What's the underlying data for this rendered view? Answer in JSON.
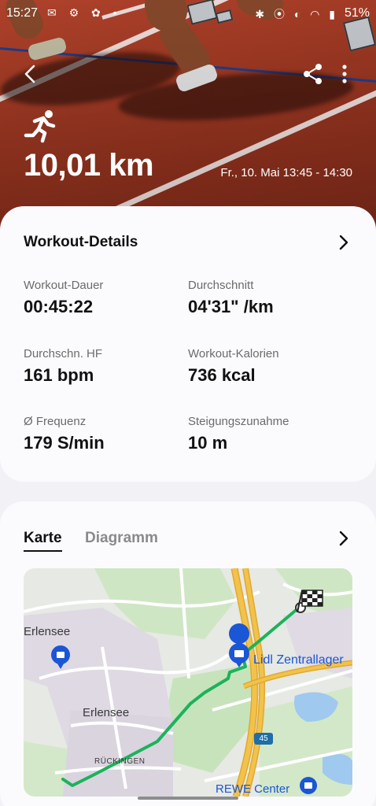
{
  "status_bar": {
    "time": "15:27",
    "battery": "51%"
  },
  "hero": {
    "distance": "10,01 km",
    "date_range": "Fr., 10. Mai 13:45 - 14:30"
  },
  "details": {
    "title": "Workout-Details",
    "metrics": [
      {
        "label": "Workout-Dauer",
        "value": "00:45:22"
      },
      {
        "label": "Durchschnitt",
        "value": "04'31\" /km"
      },
      {
        "label": "Durchschn. HF",
        "value": "161 bpm"
      },
      {
        "label": "Workout-Kalorien",
        "value": "736 kcal"
      },
      {
        "label": "Ø Frequenz",
        "value": "179 S/min"
      },
      {
        "label": "Steigungszunahme",
        "value": "10 m"
      }
    ]
  },
  "map_card": {
    "tabs": [
      {
        "label": "Karte",
        "active": true
      },
      {
        "label": "Diagramm",
        "active": false
      }
    ],
    "map_labels": {
      "erlensee_top": "Erlensee",
      "erlensee_center": "Erlensee",
      "rueckingen": "RÜCKINGEN",
      "lidl": "Lidl Zentrallager",
      "rewe": "REWE Center",
      "road_badge": "45"
    },
    "colors": {
      "route": "#1bb35a",
      "highway": "#f2c24b",
      "pin": "#1a56d6"
    }
  },
  "icons": [
    "back-icon",
    "share-icon",
    "more-icon",
    "running-icon",
    "chevron-right-icon",
    "finish-flag-icon",
    "shopping-pin-icon"
  ]
}
